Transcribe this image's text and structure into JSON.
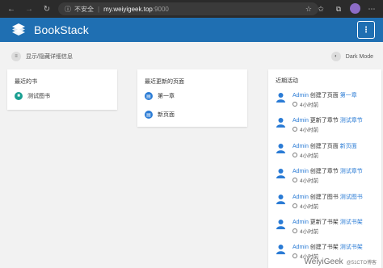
{
  "browser": {
    "back_icon": "arrow-left-icon",
    "forward_icon": "arrow-right-icon",
    "reload_icon": "reload-icon",
    "security_label": "不安全",
    "url_host": "my.weiyigeek.top",
    "url_port": ":9000"
  },
  "app": {
    "title": "BookStack",
    "menu_label": "⋮"
  },
  "toolbar": {
    "toggle_details_label": "显示/隐藏详细信息",
    "dark_mode_label": "Dark Mode"
  },
  "recent_books": {
    "title": "最近的书",
    "items": [
      {
        "label": "测试图书"
      }
    ]
  },
  "recent_pages": {
    "title": "最近更新的页面",
    "items": [
      {
        "label": "第一章"
      },
      {
        "label": "新页面"
      }
    ]
  },
  "activity": {
    "title": "近期活动",
    "items": [
      {
        "user": "Admin",
        "action": "创建了页面",
        "entity": "第一章",
        "time": "4小时前"
      },
      {
        "user": "Admin",
        "action": "更新了章节",
        "entity": "测试章节",
        "time": "4小时前"
      },
      {
        "user": "Admin",
        "action": "创建了页面",
        "entity": "新页面",
        "time": "4小时前"
      },
      {
        "user": "Admin",
        "action": "创建了章节",
        "entity": "测试章节",
        "time": "4小时前"
      },
      {
        "user": "Admin",
        "action": "创建了图书",
        "entity": "测试图书",
        "time": "4小时前"
      },
      {
        "user": "Admin",
        "action": "更新了书架",
        "entity": "测试书架",
        "time": "4小时前"
      },
      {
        "user": "Admin",
        "action": "创建了书架",
        "entity": "测试书架",
        "time": "4小时前"
      }
    ]
  },
  "watermark": {
    "brand": "WeiyiGeek",
    "sub": "@51CTO博客"
  }
}
